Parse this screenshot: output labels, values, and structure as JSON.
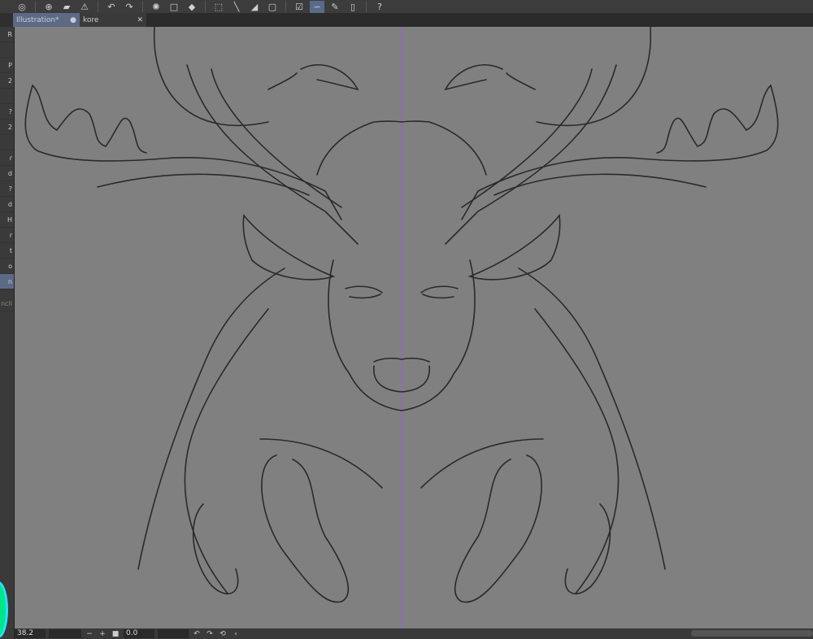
{
  "toolbar": {
    "icons": [
      "app-logo-icon",
      "new-file-icon",
      "open-folder-icon",
      "warning-export-icon",
      "undo-icon",
      "redo-icon",
      "loading-spinner-icon",
      "clear-icon",
      "fill-icon",
      "select-transform-icon",
      "ruler-icon",
      "gradient-icon",
      "frame-icon",
      "check-icon",
      "stabilizer-icon",
      "pen-pressure-icon",
      "device-icon",
      "help-icon"
    ],
    "active_icon": "stabilizer-icon"
  },
  "tabs": [
    {
      "label": "Illustration*",
      "active": true,
      "marker": "●"
    },
    {
      "label": "kore",
      "active": false,
      "marker": "✕"
    }
  ],
  "left_panel": {
    "letters": [
      "R",
      "",
      "P",
      "2",
      "",
      "?",
      "2",
      "",
      "r",
      "d",
      "?",
      "d",
      "H",
      "r",
      "t",
      "o",
      "n"
    ],
    "field_label": "ncil"
  },
  "status": {
    "zoom": "38.2",
    "angle": "0.0",
    "minus": "−",
    "plus": "+"
  },
  "colors": {
    "canvas": "#808080",
    "guide_line": "#9a5fd0",
    "accent_color_wheel": "#00e58a"
  }
}
